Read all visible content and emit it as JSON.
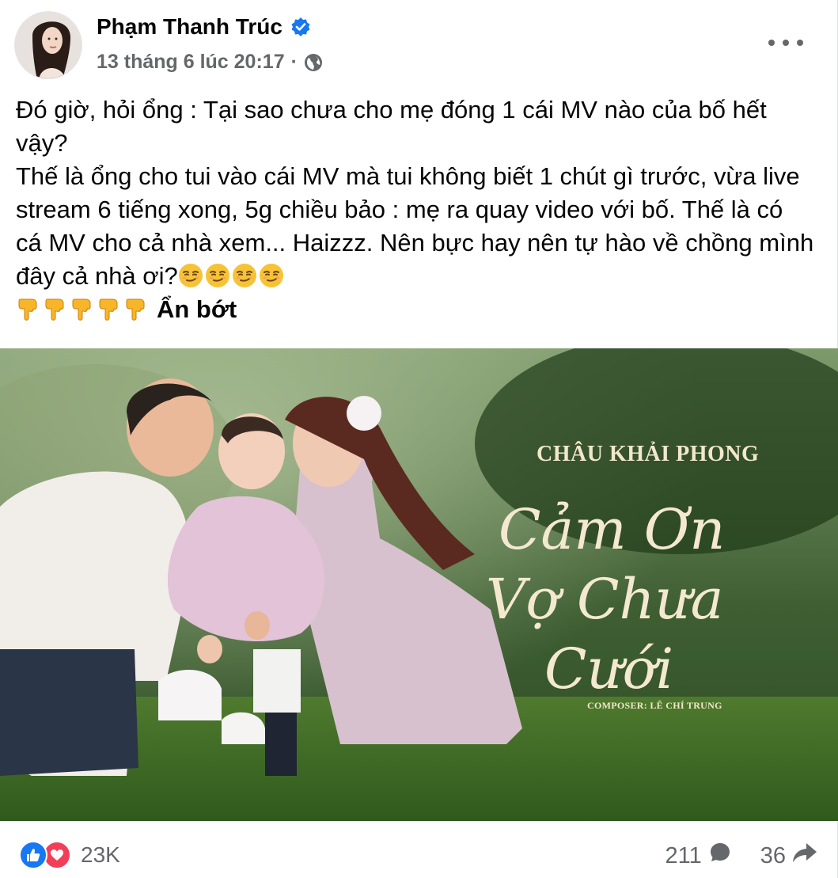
{
  "post": {
    "author": "Phạm Thanh Trúc",
    "timestamp": "13 tháng 6 lúc 20:17",
    "separator": "·",
    "privacy_icon": "globe-icon",
    "verified_icon": "verified-badge-icon",
    "more_icon": "more-horizontal-icon",
    "text_lines": [
      "Đó giờ, hỏi ổng : Tại sao chưa cho mẹ đóng 1 cái MV nào của bố hết vậy?",
      "Thế là ổng cho tui vào cái MV mà tui không biết 1 chút gì trước, vừa live stream 6 tiếng xong, 5g chiều bảo : mẹ ra quay video với bố. Thế là có cá MV cho cả nhà xem... Haizzz. Nên bực hay nên tự hào về chồng mình đây cả nhà ơi?"
    ],
    "see_less": "Ẩn bớt",
    "emoji_smirk_count": 4,
    "emoji_pointing_count": 5
  },
  "image": {
    "artist": "CHÂU KHẢI PHONG",
    "song_lines": [
      "Cảm Ơn",
      "Vợ Chưa",
      "Cưới"
    ],
    "composer": "COMPOSER: LÊ CHÍ TRUNG"
  },
  "footer": {
    "reaction_count": "23K",
    "comment_count": "211",
    "share_count": "36",
    "like_icon": "like-thumb-icon",
    "love_icon": "love-heart-icon",
    "comment_icon": "comment-bubble-icon",
    "share_icon": "share-arrow-icon"
  },
  "colors": {
    "like_blue": "#1877f2",
    "love_red": "#f33e58",
    "secondary_text": "#65676b",
    "verified_blue": "#1877f2"
  }
}
